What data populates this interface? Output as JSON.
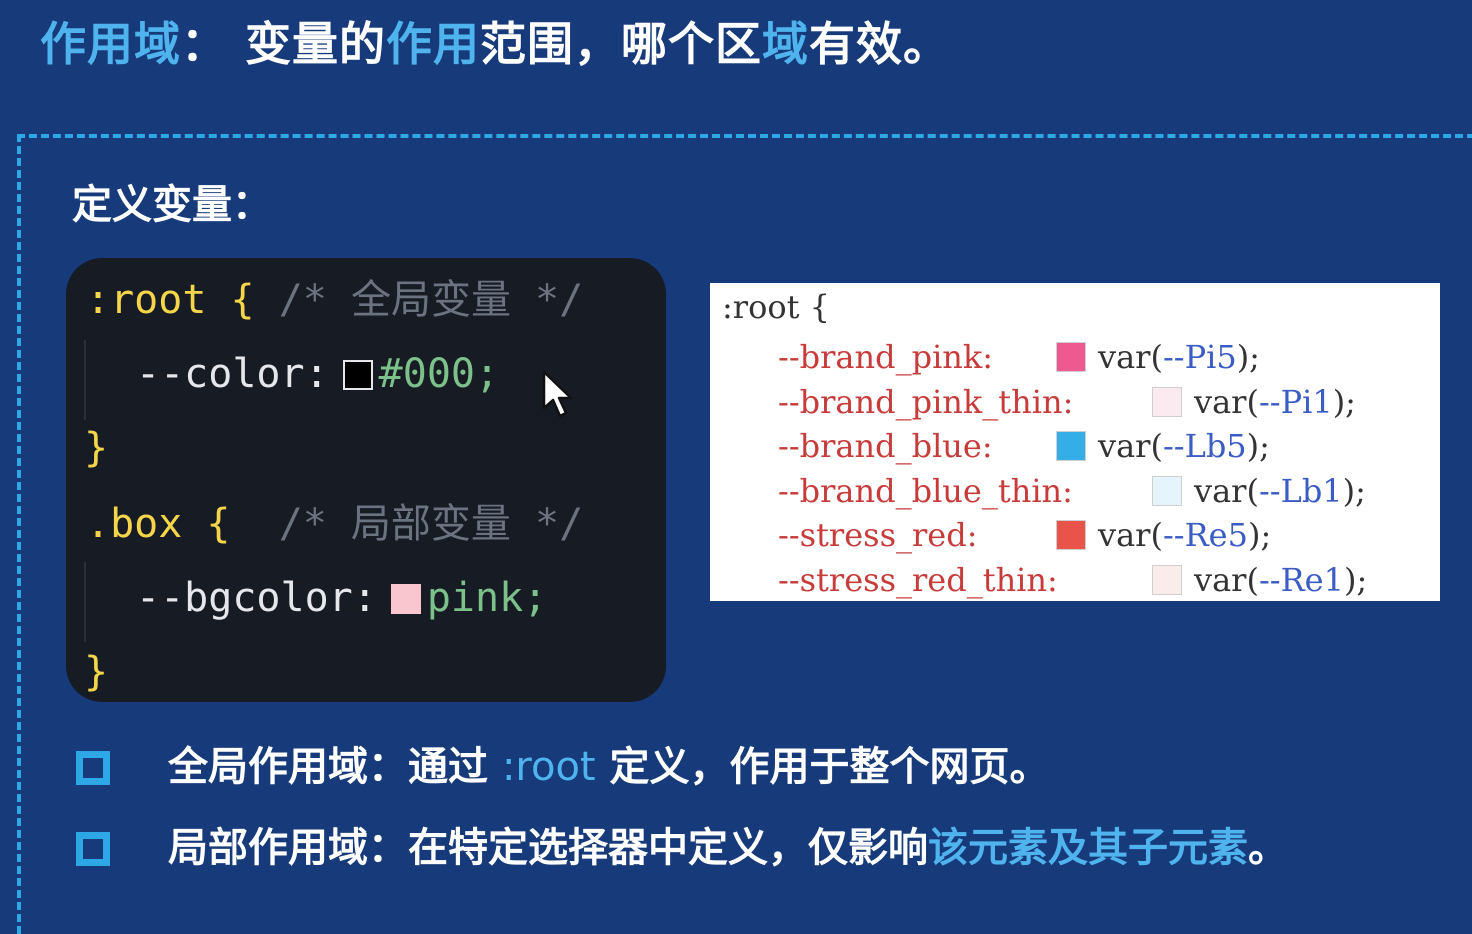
{
  "heading": {
    "term": "作用域",
    "colon": "：",
    "part1": "变量的",
    "part2": "作用",
    "part3": "范围，哪个区",
    "part4": "域",
    "part5": "有效。"
  },
  "section_title": "定义变量：",
  "code_dark": {
    "root_selector": ":root",
    "open_brace": "{",
    "root_comment": "/* 全局变量 */",
    "color_prop": "--color:",
    "color_value": "#000;",
    "close_brace": "}",
    "box_selector": ".box",
    "box_comment": "/* 局部变量 */",
    "bgcolor_prop": "--bgcolor:",
    "bgcolor_value": "pink;",
    "color_swatch": "#000000",
    "pink_swatch": "#f9c6d0"
  },
  "code_light": {
    "selector": ":root {",
    "lines": [
      {
        "prop": "--brand_pink:",
        "fn": "var(",
        "arg": "--Pi5",
        "end": ");",
        "swatch": "#ee5a8f"
      },
      {
        "prop": "--brand_pink_thin:",
        "fn": "var(",
        "arg": "--Pi1",
        "end": ");",
        "swatch": "#fbeaf0"
      },
      {
        "prop": "--brand_blue:",
        "fn": "var(",
        "arg": "--Lb5",
        "end": ");",
        "swatch": "#35aee8"
      },
      {
        "prop": "--brand_blue_thin:",
        "fn": "var(",
        "arg": "--Lb1",
        "end": ");",
        "swatch": "#e6f5fc"
      },
      {
        "prop": "--stress_red:",
        "fn": "var(",
        "arg": "--Re5",
        "end": ");",
        "swatch": "#e9544a"
      },
      {
        "prop": "--stress_red_thin:",
        "fn": "var(",
        "arg": "--Re1",
        "end": ");",
        "swatch": "#fbecec"
      }
    ]
  },
  "bullets": [
    {
      "label": "全局作用域：通过 ",
      "highlight": ":root",
      "rest": " 定义，作用于整个网页。",
      "tail": ""
    },
    {
      "label": "局部作用域：在特定选择器中定义，仅影响",
      "highlight": "该元素及其子元素",
      "rest": "",
      "tail": "。"
    }
  ],
  "colors": {
    "background": "#173a7a",
    "accent": "#4fb3ee",
    "dash": "#2ea7e6",
    "code_bg": "#171b24"
  },
  "icons": {
    "cursor": "mouse-pointer-icon",
    "bullet": "square-bullet-icon"
  }
}
